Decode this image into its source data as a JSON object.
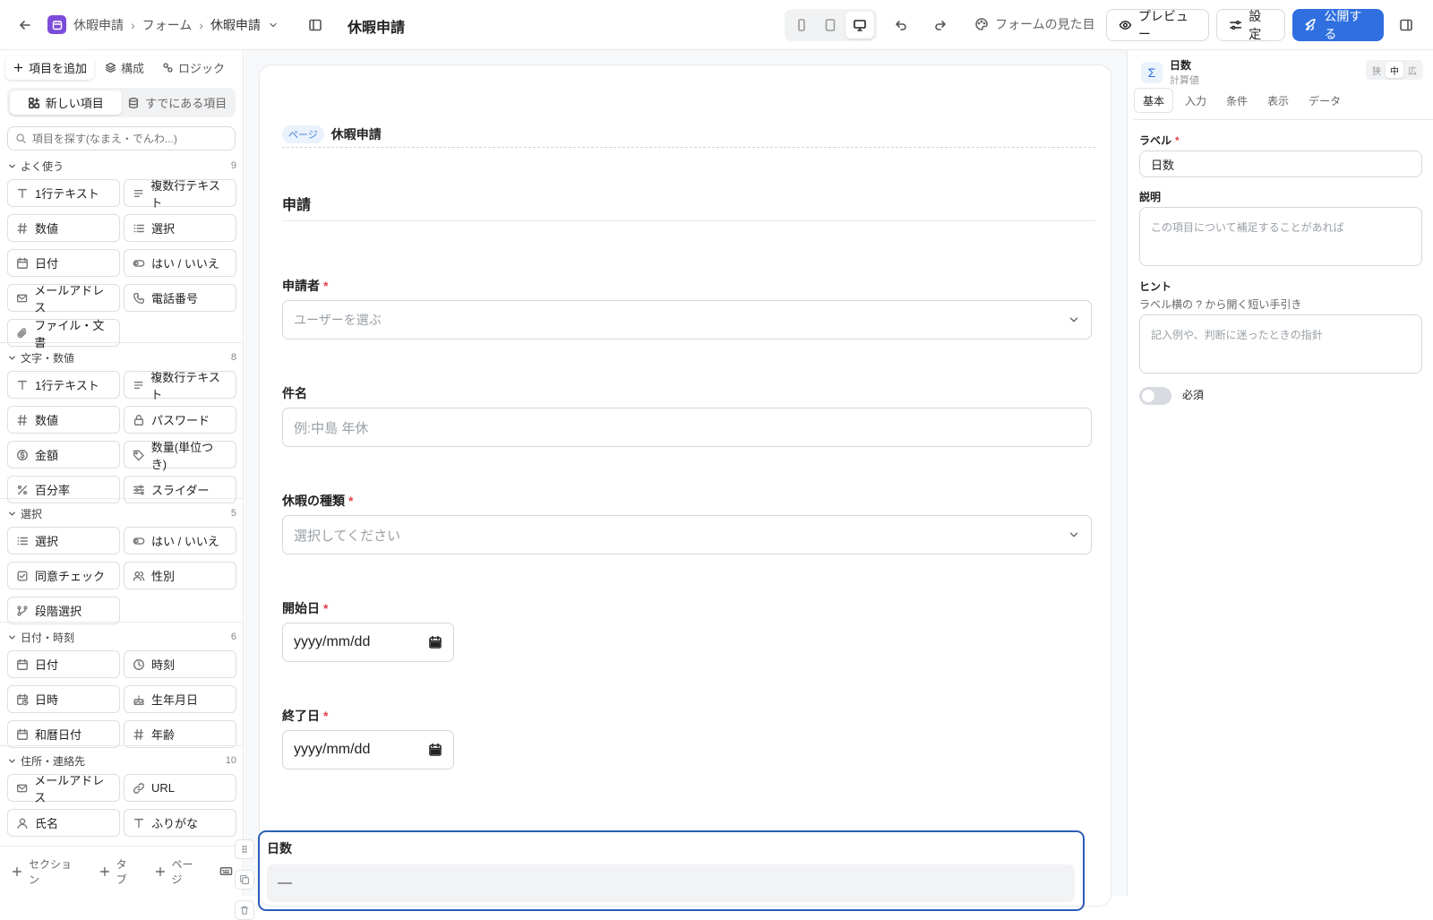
{
  "header": {
    "breadcrumb": [
      "休暇申請",
      "フォーム",
      "休暇申請"
    ],
    "page_title": "休暇申請",
    "appearance_label": "フォームの見た目",
    "preview_label": "プレビュー",
    "settings_label": "設定",
    "publish_label": "公開する",
    "colors": {
      "app_icon": "#7c4ddb",
      "publish": "#2f6fdf"
    }
  },
  "left": {
    "tabs": [
      "項目を追加",
      "構成",
      "ロジック"
    ],
    "segments": [
      "新しい項目",
      "すでにある項目"
    ],
    "search_placeholder": "項目を探す(なまえ・でんわ...)",
    "sections": [
      {
        "title": "よく使う",
        "count": "9",
        "items": [
          {
            "label": "1行テキスト",
            "icon": "text-icon"
          },
          {
            "label": "複数行テキスト",
            "icon": "multiline-icon"
          },
          {
            "label": "数値",
            "icon": "hash-icon"
          },
          {
            "label": "選択",
            "icon": "list-icon"
          },
          {
            "label": "日付",
            "icon": "calendar-icon"
          },
          {
            "label": "はい / いいえ",
            "icon": "toggle-icon"
          },
          {
            "label": "メールアドレス",
            "icon": "mail-icon"
          },
          {
            "label": "電話番号",
            "icon": "phone-icon"
          },
          {
            "label": "ファイル・文書",
            "icon": "paperclip-icon"
          }
        ]
      },
      {
        "title": "文字・数値",
        "count": "8",
        "items": [
          {
            "label": "1行テキスト",
            "icon": "text-icon"
          },
          {
            "label": "複数行テキスト",
            "icon": "multiline-icon"
          },
          {
            "label": "数値",
            "icon": "hash-icon"
          },
          {
            "label": "パスワード",
            "icon": "lock-icon"
          },
          {
            "label": "金額",
            "icon": "currency-icon"
          },
          {
            "label": "数量(単位つき)",
            "icon": "tag-icon"
          },
          {
            "label": "百分率",
            "icon": "percent-icon"
          },
          {
            "label": "スライダー",
            "icon": "slider-icon"
          }
        ]
      },
      {
        "title": "選択",
        "count": "5",
        "items": [
          {
            "label": "選択",
            "icon": "list-icon"
          },
          {
            "label": "はい / いいえ",
            "icon": "toggle-icon"
          },
          {
            "label": "同意チェック",
            "icon": "checkbox-icon"
          },
          {
            "label": "性別",
            "icon": "users-icon"
          },
          {
            "label": "段階選択",
            "icon": "branch-icon"
          }
        ]
      },
      {
        "title": "日付・時刻",
        "count": "6",
        "items": [
          {
            "label": "日付",
            "icon": "calendar-icon"
          },
          {
            "label": "時刻",
            "icon": "clock-icon"
          },
          {
            "label": "日時",
            "icon": "calendar-clock-icon"
          },
          {
            "label": "生年月日",
            "icon": "cake-icon"
          },
          {
            "label": "和暦日付",
            "icon": "calendar-icon"
          },
          {
            "label": "年齢",
            "icon": "hash-icon"
          }
        ]
      },
      {
        "title": "住所・連絡先",
        "count": "10",
        "items": [
          {
            "label": "メールアドレス",
            "icon": "mail-icon"
          },
          {
            "label": "URL",
            "icon": "link-icon"
          },
          {
            "label": "氏名",
            "icon": "user-icon"
          },
          {
            "label": "ふりがな",
            "icon": "text-icon"
          }
        ]
      }
    ],
    "footer": [
      "セクション",
      "タブ",
      "ページ"
    ]
  },
  "canvas": {
    "page_chip": "ページ",
    "page_name": "休暇申請",
    "section_title": "申請",
    "fields": {
      "applicant": {
        "label": "申請者",
        "placeholder": "ユーザーを選ぶ"
      },
      "subject": {
        "label": "件名",
        "placeholder": "例:中島 年休"
      },
      "leave_type": {
        "label": "休暇の種類",
        "placeholder": "選択してください"
      },
      "start": {
        "label": "開始日",
        "value": "yyyy/mm/dd"
      },
      "end": {
        "label": "終了日",
        "value": "yyyy/mm/dd"
      },
      "days": {
        "label": "日数",
        "value": "—"
      }
    },
    "required_mark": "*"
  },
  "right": {
    "field_name": "日数",
    "field_type": "計算値",
    "width_options": [
      "狭",
      "中",
      "広"
    ],
    "tabs": [
      "基本",
      "入力",
      "条件",
      "表示",
      "データ"
    ],
    "label_title": "ラベル",
    "label_value": "日数",
    "desc_title": "説明",
    "desc_placeholder": "この項目について補足することがあれば",
    "hint_title": "ヒント",
    "hint_sub": "ラベル横の ? から開く短い手引き",
    "hint_placeholder": "記入例や、判断に迷ったときの指針",
    "required_label": "必須",
    "required_on": false
  }
}
